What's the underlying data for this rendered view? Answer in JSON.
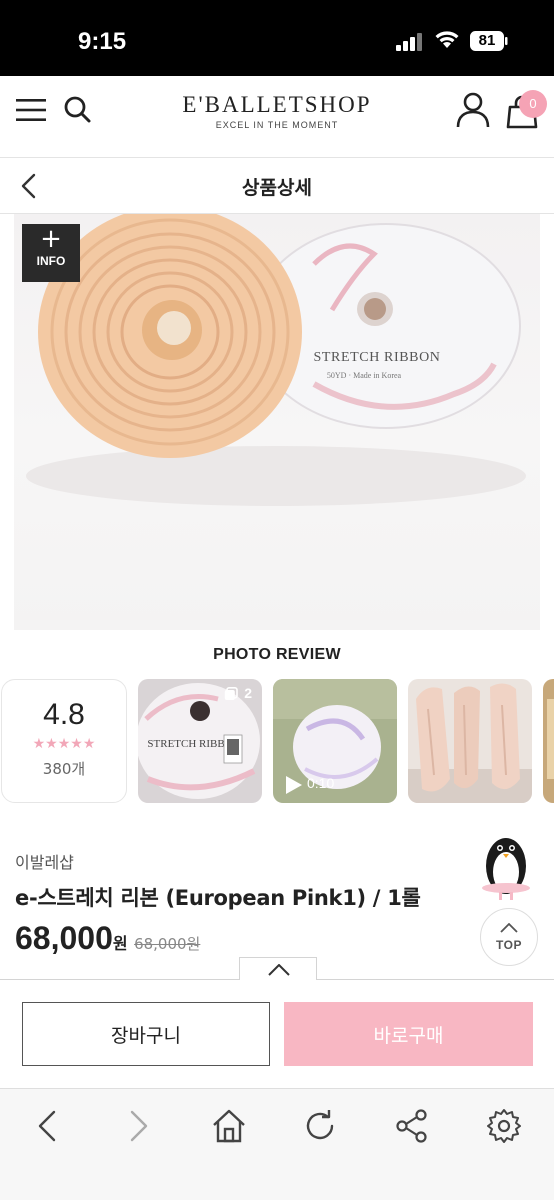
{
  "status_bar": {
    "time": "9:15",
    "battery": "81"
  },
  "header": {
    "logo_main": "E'BALLETSHOP",
    "logo_sub": "EXCEL IN THE MOMENT",
    "cart_count": "0",
    "icons": [
      "hamburger-icon",
      "search-icon",
      "user-icon",
      "cart-icon"
    ]
  },
  "subheader": {
    "title": "상품상세"
  },
  "product_image": {
    "info_plus": "+",
    "info_label": "INFO",
    "spool_text": "STRETCH RIBBON",
    "spool_subtext": "50YD · Made in Korea"
  },
  "photo_review": {
    "title": "PHOTO REVIEW",
    "rating": "4.8",
    "stars": "★★★★★",
    "review_count": "380개",
    "thumbnails": [
      {
        "count": "2",
        "label": "STRETCH RIBBON"
      },
      {
        "duration": "0:10"
      },
      {},
      {}
    ]
  },
  "product": {
    "brand": "이발레샵",
    "name": "e-스트레치 리본 (European Pink1) / 1롤",
    "price": "68,000",
    "price_unit": "원",
    "original_price": "68,000원"
  },
  "top_button": {
    "label": "TOP"
  },
  "buy_bar": {
    "cart_label": "장바구니",
    "buy_label": "바로구매"
  },
  "colors": {
    "accent_pink": "#f8b7c3",
    "badge_pink": "#f5a3b5",
    "star_pink": "#f2a7b8"
  }
}
